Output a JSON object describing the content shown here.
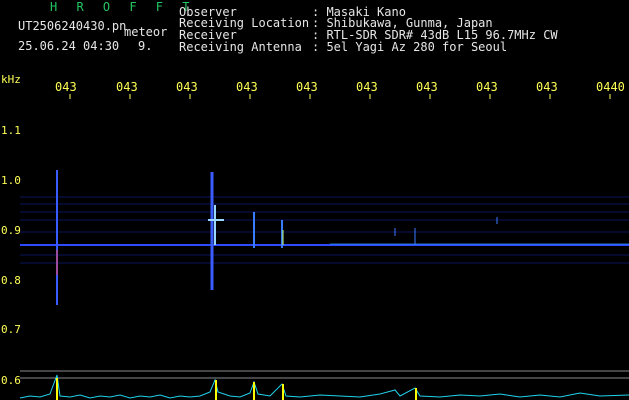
{
  "header": {
    "station_title": "H R O F F T",
    "file_name": "UT2506240430.pn",
    "meteor_label": "meteor",
    "date_time": "25.06.24 04:30",
    "count": "9."
  },
  "info": {
    "observer_label": "Observer",
    "observer_value": ": Masaki Kano",
    "location_label": "Receiving Location",
    "location_value": ": Shibukawa, Gunma, Japan",
    "receiver_label": "Receiver",
    "receiver_value": ": RTL-SDR SDR# 43dB L15 96.7MHz CW",
    "antenna_label": "Receiving Antenna",
    "antenna_value": ": 5el Yagi Az 280 for Seoul"
  },
  "axis": {
    "unit_label": "kHz",
    "time_ticks": [
      "043",
      "043",
      "043",
      "043",
      "043",
      "043",
      "043",
      "043",
      "043",
      "0440"
    ],
    "freq_ticks": [
      "1.1",
      "1.0",
      "0.9",
      "0.8",
      "0.7",
      "0.6"
    ]
  },
  "colors": {
    "background": "#000000",
    "text_white": "#e6e6e6",
    "text_yellow": "#ffff55",
    "title_green": "#22c55e",
    "signal_blue": "#1e3cff",
    "signal_yellow": "#ffff00",
    "baseline_cyan": "#22d3ee"
  }
}
